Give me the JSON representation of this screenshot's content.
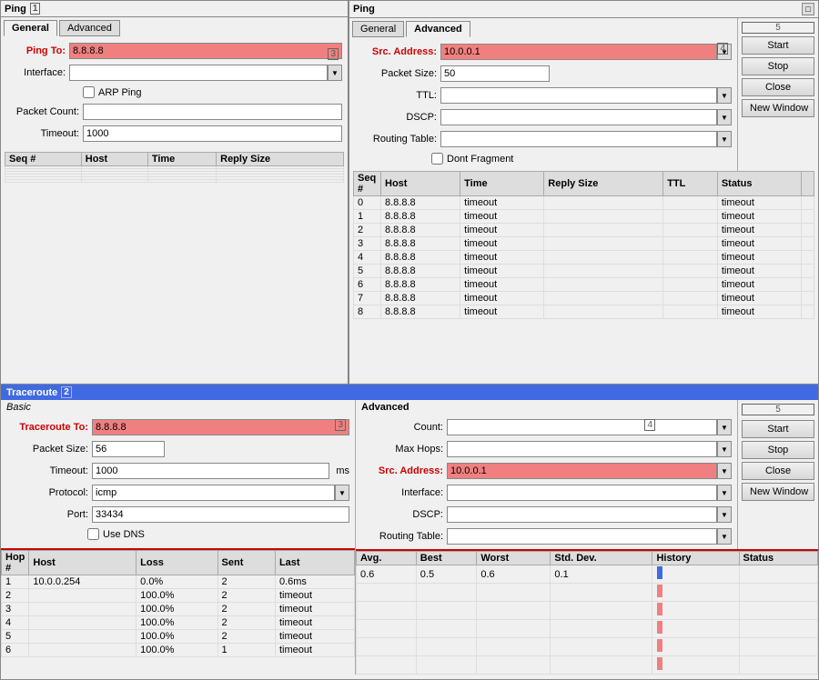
{
  "ping_window1": {
    "title": "Ping",
    "number": "1",
    "tabs": [
      "General",
      "Advanced"
    ],
    "active_tab": "General",
    "fields": {
      "ping_to_label": "Ping To:",
      "ping_to_value": "8.8.8.8",
      "interface_label": "Interface:",
      "arp_ping_label": "ARP Ping",
      "packet_count_label": "Packet Count:",
      "timeout_label": "Timeout:",
      "timeout_value": "1000"
    },
    "columns": [
      "Seq #",
      "Host",
      "Time",
      "Reply Size"
    ],
    "number_badge": "3"
  },
  "ping_window2": {
    "title": "Ping",
    "number": "5",
    "tabs": [
      "General",
      "Advanced"
    ],
    "active_tab": "Advanced",
    "buttons": [
      "Start",
      "Stop",
      "Close",
      "New Window"
    ],
    "fields": {
      "src_address_label": "Src. Address:",
      "src_address_value": "10.0.0.1",
      "packet_size_label": "Packet Size:",
      "packet_size_value": "50",
      "ttl_label": "TTL:",
      "dscp_label": "DSCP:",
      "routing_table_label": "Routing Table:",
      "dont_fragment_label": "Dont Fragment"
    },
    "number_badge": "4",
    "columns": [
      "Seq #",
      "Host",
      "Time",
      "Reply Size",
      "TTL",
      "Status"
    ],
    "rows": [
      {
        "seq": "0",
        "host": "8.8.8.8",
        "time": "timeout",
        "reply_size": "",
        "ttl": "",
        "status": "timeout"
      },
      {
        "seq": "1",
        "host": "8.8.8.8",
        "time": "timeout",
        "reply_size": "",
        "ttl": "",
        "status": "timeout"
      },
      {
        "seq": "2",
        "host": "8.8.8.8",
        "time": "timeout",
        "reply_size": "",
        "ttl": "",
        "status": "timeout"
      },
      {
        "seq": "3",
        "host": "8.8.8.8",
        "time": "timeout",
        "reply_size": "",
        "ttl": "",
        "status": "timeout"
      },
      {
        "seq": "4",
        "host": "8.8.8.8",
        "time": "timeout",
        "reply_size": "",
        "ttl": "",
        "status": "timeout"
      },
      {
        "seq": "5",
        "host": "8.8.8.8",
        "time": "timeout",
        "reply_size": "",
        "ttl": "",
        "status": "timeout"
      },
      {
        "seq": "6",
        "host": "8.8.8.8",
        "time": "timeout",
        "reply_size": "",
        "ttl": "",
        "status": "timeout"
      },
      {
        "seq": "7",
        "host": "8.8.8.8",
        "time": "timeout",
        "reply_size": "",
        "ttl": "",
        "status": "timeout"
      },
      {
        "seq": "8",
        "host": "8.8.8.8",
        "time": "timeout",
        "reply_size": "",
        "ttl": "",
        "status": "timeout"
      }
    ]
  },
  "traceroute_window": {
    "title": "Traceroute",
    "number": "2",
    "basic_tab": "Basic",
    "advanced_label": "Advanced",
    "number_badge3": "3",
    "number_badge4": "4",
    "number_badge5": "5",
    "basic_fields": {
      "traceroute_to_label": "Traceroute To:",
      "traceroute_to_value": "8.8.8.8",
      "packet_size_label": "Packet Size:",
      "packet_size_value": "56",
      "timeout_label": "Timeout:",
      "timeout_value": "1000",
      "timeout_unit": "ms",
      "protocol_label": "Protocol:",
      "protocol_value": "icmp",
      "port_label": "Port:",
      "port_value": "33434",
      "use_dns_label": "Use DNS"
    },
    "advanced_fields": {
      "count_label": "Count:",
      "max_hops_label": "Max Hops:",
      "src_address_label": "Src. Address:",
      "src_address_value": "10.0.0.1",
      "interface_label": "Interface:",
      "dscp_label": "DSCP:",
      "routing_table_label": "Routing Table:"
    },
    "buttons": [
      "Start",
      "Stop",
      "Close",
      "New Window"
    ],
    "columns": [
      "Hop #",
      "Host",
      "Loss",
      "Sent",
      "Last",
      "Avg.",
      "Best",
      "Worst",
      "Std. Dev.",
      "History",
      "Status"
    ],
    "rows": [
      {
        "hop": "1",
        "host": "10.0.0.254",
        "loss": "0.0%",
        "sent": "2",
        "last": "0.6ms",
        "avg": "0.6",
        "best": "0.5",
        "worst": "0.6",
        "stddev": "0.1",
        "history": "blue",
        "status": ""
      },
      {
        "hop": "2",
        "host": "",
        "loss": "100.0%",
        "sent": "2",
        "last": "timeout",
        "avg": "",
        "best": "",
        "worst": "",
        "stddev": "",
        "history": "red",
        "status": ""
      },
      {
        "hop": "3",
        "host": "",
        "loss": "100.0%",
        "sent": "2",
        "last": "timeout",
        "avg": "",
        "best": "",
        "worst": "",
        "stddev": "",
        "history": "red",
        "status": ""
      },
      {
        "hop": "4",
        "host": "",
        "loss": "100.0%",
        "sent": "2",
        "last": "timeout",
        "avg": "",
        "best": "",
        "worst": "",
        "stddev": "",
        "history": "red",
        "status": ""
      },
      {
        "hop": "5",
        "host": "",
        "loss": "100.0%",
        "sent": "2",
        "last": "timeout",
        "avg": "",
        "best": "",
        "worst": "",
        "stddev": "",
        "history": "red",
        "status": ""
      },
      {
        "hop": "6",
        "host": "",
        "loss": "100.0%",
        "sent": "1",
        "last": "timeout",
        "avg": "",
        "best": "",
        "worst": "",
        "stddev": "",
        "history": "red",
        "status": ""
      }
    ]
  }
}
